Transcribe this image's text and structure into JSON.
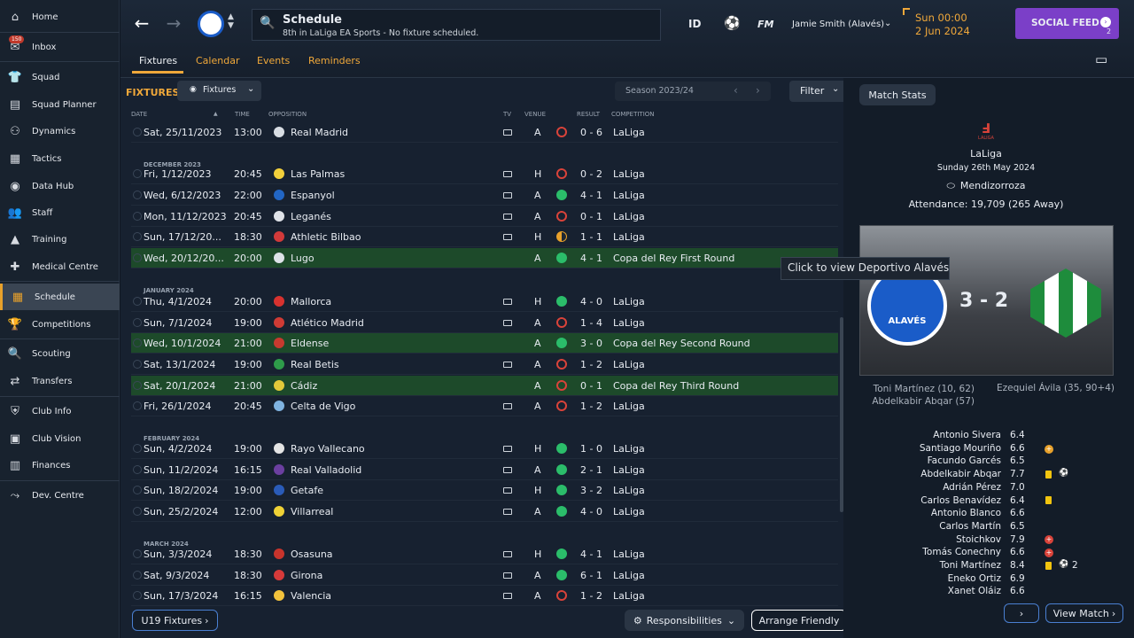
{
  "sidebar": {
    "inbox_badge": "150",
    "items": [
      {
        "label": "Home",
        "icon": "home-icon"
      },
      {
        "label": "Inbox",
        "icon": "inbox-icon"
      },
      {
        "label": "Squad",
        "icon": "shirt-icon"
      },
      {
        "label": "Squad Planner",
        "icon": "clipboard-icon"
      },
      {
        "label": "Dynamics",
        "icon": "dynamics-icon"
      },
      {
        "label": "Tactics",
        "icon": "tactics-icon"
      },
      {
        "label": "Data Hub",
        "icon": "data-hub-icon"
      },
      {
        "label": "Staff",
        "icon": "staff-icon"
      },
      {
        "label": "Training",
        "icon": "training-icon"
      },
      {
        "label": "Medical Centre",
        "icon": "medical-icon"
      },
      {
        "label": "Schedule",
        "icon": "calendar-icon"
      },
      {
        "label": "Competitions",
        "icon": "trophy-icon"
      },
      {
        "label": "Scouting",
        "icon": "scouting-icon"
      },
      {
        "label": "Transfers",
        "icon": "transfers-icon"
      },
      {
        "label": "Club Info",
        "icon": "shield-icon"
      },
      {
        "label": "Club Vision",
        "icon": "briefcase-icon"
      },
      {
        "label": "Finances",
        "icon": "finances-icon"
      },
      {
        "label": "Dev. Centre",
        "icon": "dev-centre-icon"
      }
    ]
  },
  "header": {
    "title": "Schedule",
    "subtitle": "8th in LaLiga EA Sports - No fixture scheduled.",
    "id_label": "ID",
    "fm_label": "FM",
    "manager": "Jamie Smith (Alavés)",
    "day_time": "Sun 00:00",
    "date": "2 Jun 2024",
    "social_feed": "SOCIAL FEED",
    "social_count": "2",
    "tabs": [
      "Fixtures",
      "Calendar",
      "Events",
      "Reminders"
    ]
  },
  "toolbar": {
    "section": "FIXTURES",
    "view_label": "Fixtures",
    "season": "Season 2023/24",
    "filter": "Filter",
    "match_stats": "Match Stats"
  },
  "columns": [
    "DATE",
    "TIME",
    "OPPOSITION",
    "TV",
    "VENUE",
    "RESULT",
    "COMPETITION"
  ],
  "months": [
    "DECEMBER 2023",
    "JANUARY 2024",
    "FEBRUARY 2024",
    "MARCH 2024"
  ],
  "fixtures": [
    {
      "date": "Sat, 25/11/2023",
      "time": "13:00",
      "opp": "Real Madrid",
      "tv": true,
      "venue": "A",
      "res": "0 - 6",
      "outcome": "loss",
      "comp": "LaLiga",
      "crest": "#d8dde3"
    },
    {
      "date": "Fri, 1/12/2023",
      "time": "20:45",
      "opp": "Las Palmas",
      "tv": true,
      "venue": "H",
      "res": "0 - 2",
      "outcome": "loss",
      "comp": "LaLiga",
      "crest": "#f2d03b"
    },
    {
      "date": "Wed, 6/12/2023",
      "time": "22:00",
      "opp": "Espanyol",
      "tv": true,
      "venue": "A",
      "res": "4 - 1",
      "outcome": "win",
      "comp": "LaLiga",
      "crest": "#2266c4"
    },
    {
      "date": "Mon, 11/12/2023",
      "time": "20:45",
      "opp": "Leganés",
      "tv": true,
      "venue": "A",
      "res": "0 - 1",
      "outcome": "loss",
      "comp": "LaLiga",
      "crest": "#dfe3e8"
    },
    {
      "date": "Sun, 17/12/20...",
      "time": "18:30",
      "opp": "Athletic Bilbao",
      "tv": true,
      "venue": "H",
      "res": "1 - 1",
      "outcome": "draw",
      "comp": "LaLiga",
      "crest": "#d23a3a"
    },
    {
      "date": "Wed, 20/12/20...",
      "time": "20:00",
      "opp": "Lugo",
      "tv": false,
      "venue": "A",
      "res": "4 - 1",
      "outcome": "win",
      "comp": "Copa del Rey First Round",
      "crest": "#dde2e8",
      "cup": true
    },
    {
      "date": "Thu, 4/1/2024",
      "time": "20:00",
      "opp": "Mallorca",
      "tv": true,
      "venue": "H",
      "res": "4 - 0",
      "outcome": "win",
      "comp": "LaLiga",
      "crest": "#d8322f"
    },
    {
      "date": "Sun, 7/1/2024",
      "time": "19:00",
      "opp": "Atlético Madrid",
      "tv": true,
      "venue": "A",
      "res": "1 - 4",
      "outcome": "loss",
      "comp": "LaLiga",
      "crest": "#cf3b35"
    },
    {
      "date": "Wed, 10/1/2024",
      "time": "21:00",
      "opp": "Eldense",
      "tv": false,
      "venue": "A",
      "res": "3 - 0",
      "outcome": "win",
      "comp": "Copa del Rey Second Round",
      "crest": "#c73a2f",
      "cup": true
    },
    {
      "date": "Sat, 13/1/2024",
      "time": "19:00",
      "opp": "Real Betis",
      "tv": true,
      "venue": "A",
      "res": "1 - 2",
      "outcome": "loss",
      "comp": "LaLiga",
      "crest": "#2e9b4a"
    },
    {
      "date": "Sat, 20/1/2024",
      "time": "21:00",
      "opp": "Cádiz",
      "tv": false,
      "venue": "A",
      "res": "0 - 1",
      "outcome": "loss",
      "comp": "Copa del Rey Third Round",
      "crest": "#e2c93a",
      "cup": true
    },
    {
      "date": "Fri, 26/1/2024",
      "time": "20:45",
      "opp": "Celta de Vigo",
      "tv": true,
      "venue": "A",
      "res": "1 - 2",
      "outcome": "loss",
      "comp": "LaLiga",
      "crest": "#7fb3e0"
    },
    {
      "date": "Sun, 4/2/2024",
      "time": "19:00",
      "opp": "Rayo Vallecano",
      "tv": true,
      "venue": "H",
      "res": "1 - 0",
      "outcome": "win",
      "comp": "LaLiga",
      "crest": "#e4e4e4"
    },
    {
      "date": "Sun, 11/2/2024",
      "time": "16:15",
      "opp": "Real Valladolid",
      "tv": true,
      "venue": "A",
      "res": "2 - 1",
      "outcome": "win",
      "comp": "LaLiga",
      "crest": "#6b3fa0"
    },
    {
      "date": "Sun, 18/2/2024",
      "time": "19:00",
      "opp": "Getafe",
      "tv": true,
      "venue": "H",
      "res": "3 - 2",
      "outcome": "win",
      "comp": "LaLiga",
      "crest": "#2a5bb8"
    },
    {
      "date": "Sun, 25/2/2024",
      "time": "12:00",
      "opp": "Villarreal",
      "tv": true,
      "venue": "A",
      "res": "4 - 0",
      "outcome": "win",
      "comp": "LaLiga",
      "crest": "#f0d236"
    },
    {
      "date": "Sun, 3/3/2024",
      "time": "18:30",
      "opp": "Osasuna",
      "tv": true,
      "venue": "H",
      "res": "4 - 1",
      "outcome": "win",
      "comp": "LaLiga",
      "crest": "#c8342c"
    },
    {
      "date": "Sat, 9/3/2024",
      "time": "18:30",
      "opp": "Girona",
      "tv": true,
      "venue": "A",
      "res": "6 - 1",
      "outcome": "win",
      "comp": "LaLiga",
      "crest": "#d63a3a"
    },
    {
      "date": "Sun, 17/3/2024",
      "time": "16:15",
      "opp": "Valencia",
      "tv": true,
      "venue": "A",
      "res": "1 - 2",
      "outcome": "loss",
      "comp": "LaLiga",
      "crest": "#f2c23c"
    }
  ],
  "bottom": {
    "u19": "U19 Fixtures",
    "responsibilities": "Responsibilities",
    "arrange": "Arrange Friendly"
  },
  "match": {
    "competition": "LaLiga",
    "comp_logo": "LALIGA",
    "date": "Sunday 26th May 2024",
    "stadium": "Mendizorroza",
    "attendance": "Attendance: 19,709 (265 Away)",
    "score": "3 - 2",
    "tooltip": "Click to view Deportivo Alavés",
    "home_scorers": [
      "Toni Martínez (10, 62)",
      "Abdelkabir Abqar (57)"
    ],
    "away_scorers": [
      "Ezequiel Ávila (35, 90+4)"
    ],
    "crest_text": "ALAVÉS",
    "view_match": "View Match",
    "players": [
      {
        "name": "Antonio Sivera",
        "rating": "6.4"
      },
      {
        "name": "Santiago Mouriño",
        "rating": "6.6"
      },
      {
        "name": "Facundo Garcés",
        "rating": "6.5"
      },
      {
        "name": "Abdelkabir Abqar",
        "rating": "7.7"
      },
      {
        "name": "Adrián Pérez",
        "rating": "7.0"
      },
      {
        "name": "Carlos Benavídez",
        "rating": "6.4"
      },
      {
        "name": "Antonio Blanco",
        "rating": "6.6"
      },
      {
        "name": "Carlos Martín",
        "rating": "6.5"
      },
      {
        "name": "Stoichkov",
        "rating": "7.9"
      },
      {
        "name": "Tomás Conechny",
        "rating": "6.6"
      },
      {
        "name": "Toni Martínez",
        "rating": "8.4"
      },
      {
        "name": "Eneko Ortiz",
        "rating": "6.9"
      },
      {
        "name": "Xanet Oláiz",
        "rating": "6.6"
      }
    ],
    "toni_goals": "2"
  },
  "colors": {
    "accent": "#f0a83a",
    "win": "#2bbd6a",
    "loss": "#d9433a",
    "social": "#7b3fc8",
    "cup_row": "#1d4a2a"
  }
}
